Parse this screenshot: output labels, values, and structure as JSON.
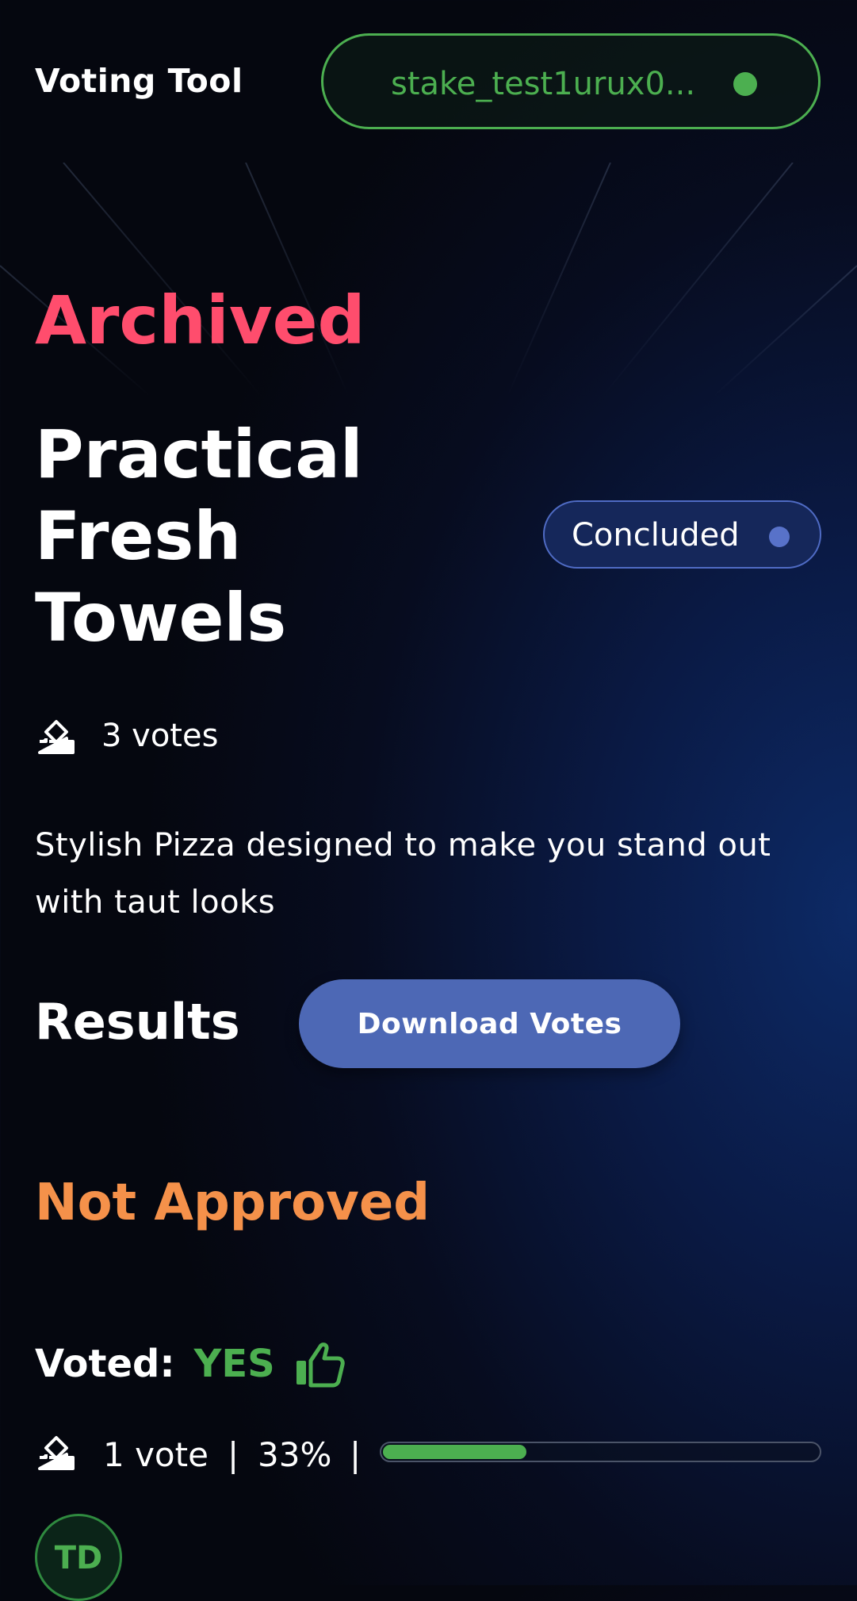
{
  "header": {
    "app_title": "Voting Tool",
    "wallet_address": "stake_test1urux0...",
    "wallet_status_color": "#4caf50"
  },
  "proposal": {
    "archive_label": "Archived",
    "title_lines": [
      "Practical",
      "Fresh",
      "Towels"
    ],
    "status": "Concluded",
    "votes_count": "3 votes",
    "description": "Stylish Pizza designed to make you stand out with taut looks"
  },
  "results": {
    "heading": "Results",
    "download_label": "Download Votes",
    "outcome": "Not Approved"
  },
  "tally": {
    "voted_label": "Voted:",
    "option": "YES",
    "vote_count": "1 vote",
    "percent_label": "33%",
    "percent": 33,
    "separator": "|",
    "voter_initials": "TD"
  },
  "colors": {
    "archived": "#ff4d6d",
    "outcome": "#f5914a",
    "yes": "#4caf50",
    "button": "#4d68b5",
    "status_pill": "#15275a"
  },
  "icons": {
    "votes": "ballot-box-icon",
    "voted_option": "thumbs-up-icon"
  }
}
